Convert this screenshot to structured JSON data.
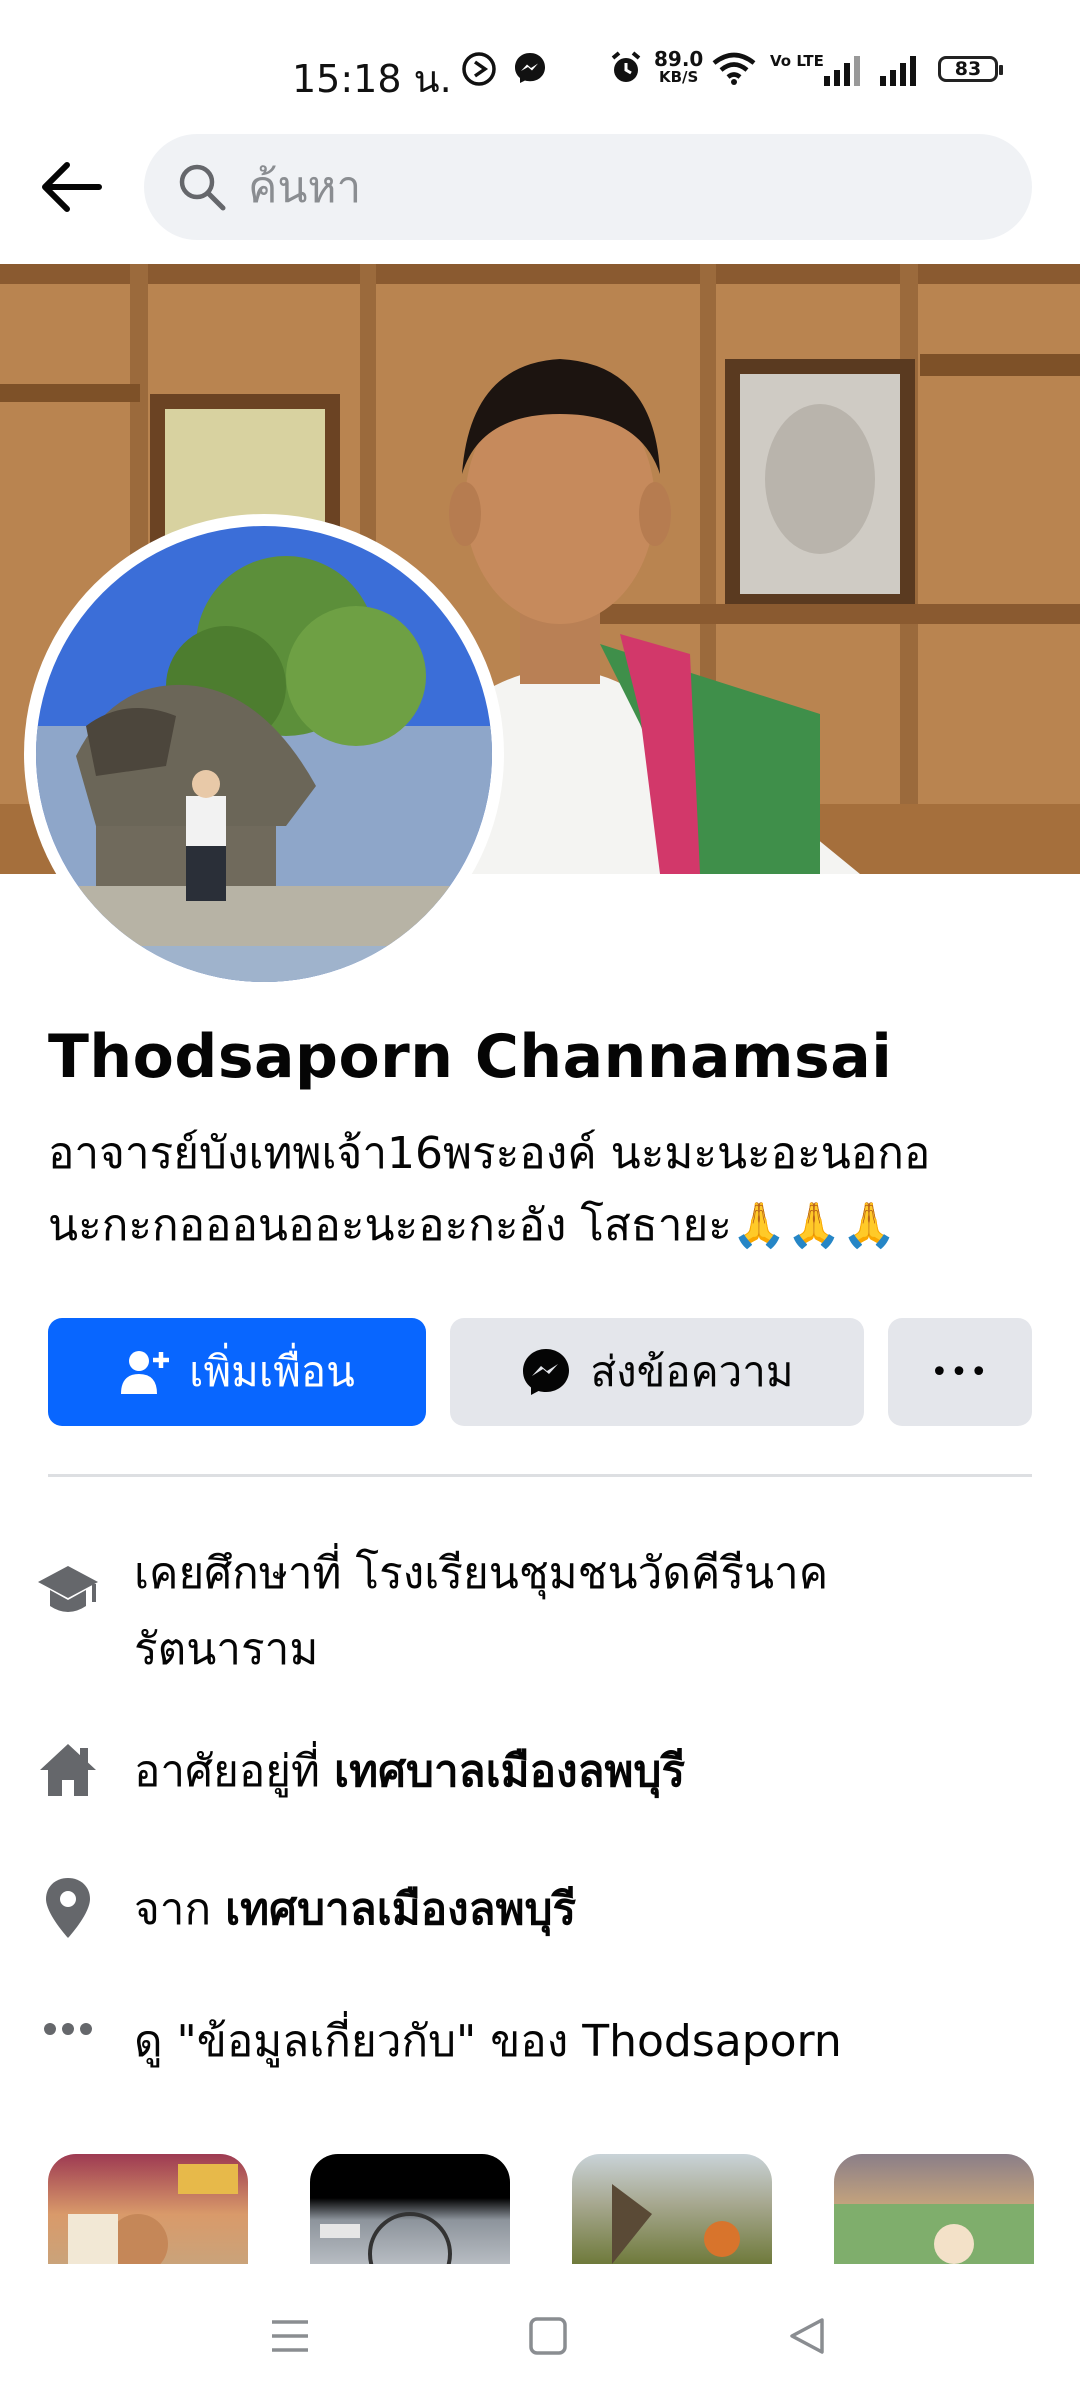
{
  "status_bar": {
    "time": "15:18 น.",
    "net_speed_value": "89.0",
    "net_speed_unit": "KB/S",
    "volte": "Vo LTE",
    "battery": "83"
  },
  "header": {
    "search_placeholder": "ค้นหา"
  },
  "profile": {
    "name": "Thodsaporn Channamsai",
    "bio_line1": "อาจารย์บังเทพเจ้า16พระองค์ นะมะนะอะนอกอ",
    "bio_line2": "นะกะกอออนออะนะอะกะอัง โสธายะ🙏🙏🙏"
  },
  "actions": {
    "add_friend": "เพิ่มเพื่อน",
    "message": "ส่งข้อความ",
    "more": "•••"
  },
  "details": {
    "education_prefix": "เคยศึกษาที่ ",
    "education_school_line1": "โรงเรียนชุมชนวัดคีรีนาค",
    "education_school_line2": "รัตนาราม",
    "lives_prefix": "อาศัยอยู่ที่ ",
    "lives_place": "เทศบาลเมืองลพบุรี",
    "from_prefix": "จาก ",
    "from_place": "เทศบาลเมืองลพบุรี",
    "about_link": "ดู \"ข้อมูลเกี่ยวกับ\" ของ Thodsaporn"
  },
  "icons": {
    "back": "arrow-left-icon",
    "search": "search-icon",
    "education": "graduation-cap-icon",
    "home": "home-icon",
    "location": "map-pin-icon",
    "more": "more-dots-icon"
  },
  "colors": {
    "primary": "#0866ff",
    "secondary_button": "#e4e6eb",
    "search_bg": "#f0f2f5",
    "icon_gray": "#65676b"
  }
}
